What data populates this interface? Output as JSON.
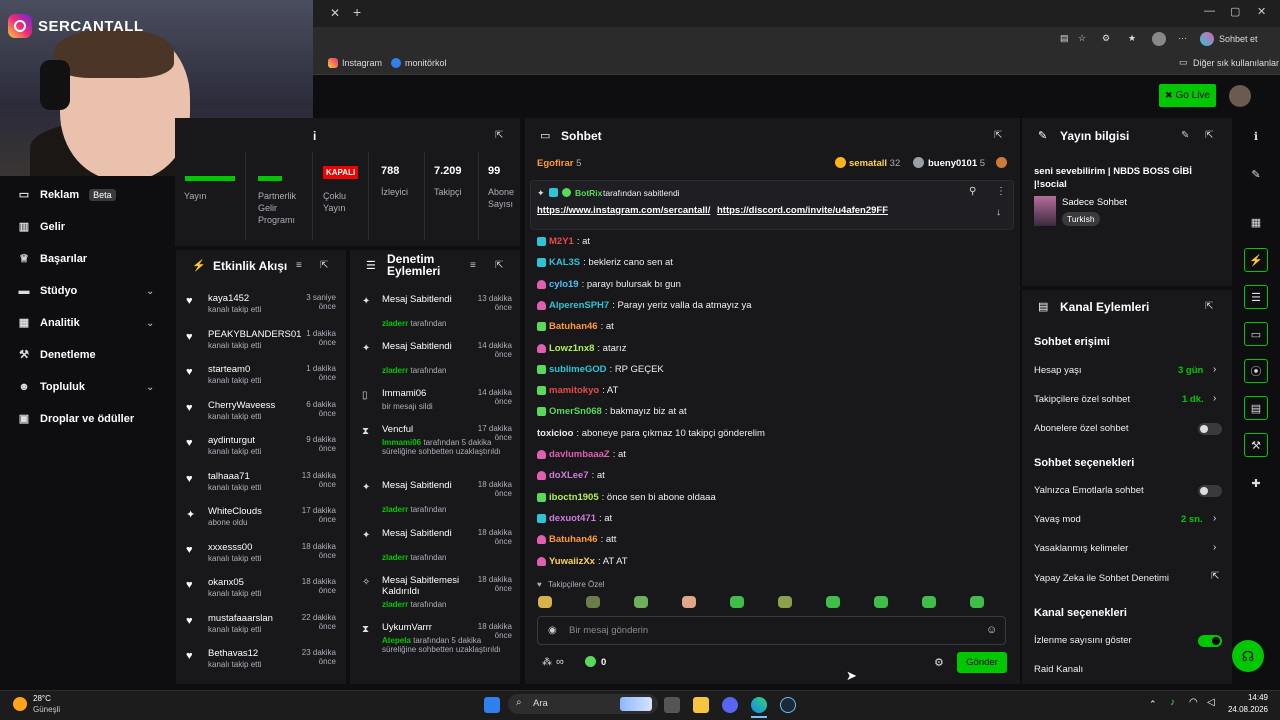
{
  "overlay": {
    "brand": "SERCANTALL"
  },
  "browser": {
    "bookmarks": [
      "Instagram",
      "monitörkol"
    ],
    "other_bookmarks": "Diğer sık kullanılanlar",
    "chat_btn": "Sohbet et"
  },
  "topnav": {
    "go_live": "Go Live"
  },
  "sidebar": {
    "items": [
      {
        "label": "Reklam",
        "badge": "Beta",
        "icon": "megaphone-icon"
      },
      {
        "label": "Gelir",
        "icon": "revenue-icon"
      },
      {
        "label": "Başarılar",
        "icon": "trophy-icon"
      },
      {
        "label": "Stüdyo",
        "icon": "studio-icon"
      },
      {
        "label": "Analitik",
        "icon": "chart-icon"
      },
      {
        "label": "Denetleme",
        "icon": "hammer-icon"
      },
      {
        "label": "Topluluk",
        "icon": "community-icon"
      },
      {
        "label": "Droplar ve ödüller",
        "icon": "gift-icon"
      }
    ]
  },
  "stats": {
    "title_fragment": "i",
    "yayin": "Yayın",
    "partner": "Partnerlik Gelir Programı",
    "kapali": "KAPALI",
    "coklu": "Çoklu Yayın",
    "viewers_value": "788",
    "viewers_label": "İzleyici",
    "followers_value": "7.209",
    "followers_label": "Takipçi",
    "subs_value": "99",
    "subs_label": "Abone Sayısı"
  },
  "activity": {
    "title": "Etkinlik Akışı",
    "items": [
      {
        "name": "kaya1452",
        "time": "3 saniye önce",
        "sub": "kanalı takip etti",
        "icon": "heart-icon"
      },
      {
        "name": "PEAKYBLANDERS01",
        "time": "1 dakika önce",
        "sub": "kanalı takip etti",
        "icon": "heart-icon"
      },
      {
        "name": "starteam0",
        "time": "1 dakika önce",
        "sub": "kanalı takip etti",
        "icon": "heart-icon"
      },
      {
        "name": "CherryWaveess",
        "time": "6 dakika önce",
        "sub": "kanalı takip etti",
        "icon": "heart-icon"
      },
      {
        "name": "aydinturgut",
        "time": "9 dakika önce",
        "sub": "kanalı takip etti",
        "icon": "heart-icon"
      },
      {
        "name": "talhaaa71",
        "time": "13 dakika önce",
        "sub": "kanalı takip etti",
        "icon": "heart-icon"
      },
      {
        "name": "WhiteClouds",
        "time": "17 dakika önce",
        "sub": "abone oldu",
        "icon": "sparkle-icon"
      },
      {
        "name": "xxxesss00",
        "time": "18 dakika önce",
        "sub": "kanalı takip etti",
        "icon": "heart-icon"
      },
      {
        "name": "okanx05",
        "time": "18 dakika önce",
        "sub": "kanalı takip etti",
        "icon": "heart-icon"
      },
      {
        "name": "mustafaaarslan",
        "time": "22 dakika önce",
        "sub": "kanalı takip etti",
        "icon": "heart-icon"
      },
      {
        "name": "Bethavas12",
        "time": "23 dakika önce",
        "sub": "kanalı takip etti",
        "icon": "heart-icon"
      }
    ]
  },
  "moderation": {
    "title": "Denetim Eylemleri",
    "items": [
      {
        "title": "Mesaj Sabitlendi",
        "time": "13 dakika önce",
        "actor": "zladerr",
        "suffix": "tarafından",
        "icon": "pin-icon"
      },
      {
        "title": "Mesaj Sabitlendi",
        "time": "14 dakika önce",
        "actor": "zladerr",
        "suffix": "tarafından",
        "icon": "pin-icon"
      },
      {
        "title": "Immami06",
        "time": "14 dakika önce",
        "actor": "",
        "suffix": "bir mesajı sildi",
        "icon": "trash-icon"
      },
      {
        "title": "Vencful",
        "time": "17 dakika önce",
        "actor": "Immami06",
        "suffix": "tarafından 5 dakika süreliğine sohbetten uzaklaştırıldı",
        "icon": "hourglass-icon"
      },
      {
        "title": "Mesaj Sabitlendi",
        "time": "18 dakika önce",
        "actor": "zladerr",
        "suffix": "tarafından",
        "icon": "pin-icon"
      },
      {
        "title": "Mesaj Sabitlendi",
        "time": "18 dakika önce",
        "actor": "zladerr",
        "suffix": "tarafından",
        "icon": "pin-icon"
      },
      {
        "title": "Mesaj Sabitlemesi Kaldırıldı",
        "time": "18 dakika önce",
        "actor": "zladerr",
        "suffix": "tarafından",
        "icon": "unpin-icon"
      },
      {
        "title": "UykumVarrr",
        "time": "18 dakika önce",
        "actor": "Atepela",
        "suffix": "tarafından 5 dakika süreliğine sohbetten uzaklaştırıldı",
        "icon": "hourglass-icon"
      }
    ]
  },
  "chat": {
    "title": "Sohbet",
    "top_users": [
      {
        "name": "Egofirar",
        "count": "5"
      },
      {
        "name": "sematall",
        "count": "32"
      },
      {
        "name": "bueny0101",
        "count": "5"
      }
    ],
    "pinned": {
      "by": "BotRix",
      "by_suffix": "tarafından sabitlendi",
      "link1": "https://www.instagram.com/sercantall/",
      "link2": "https://discord.com/invite/u4afen29FF"
    },
    "messages": [
      {
        "user": "M2Y1",
        "color": "#e64a4a",
        "text": ": at",
        "badge": "b-cyan"
      },
      {
        "user": "KAL3S",
        "color": "#2ec4d8",
        "text": ": bekleriz cano sen at",
        "badge": "b-cyan"
      },
      {
        "user": "cylo19",
        "color": "#4fc3f7",
        "text": ": parayı bulursak bı gun",
        "badge": "b-pink"
      },
      {
        "user": "AlperenSPH7",
        "color": "#2ec4d8",
        "text": ": Parayı yeriz valla da atmayız ya",
        "badge": "b-pink"
      },
      {
        "user": "Batuhan46",
        "color": "#ff9a3c",
        "text": ": at",
        "badge": "b-green"
      },
      {
        "user": "Lowz1nx8",
        "color": "#b0f050",
        "text": ": atarız",
        "badge": "b-pink"
      },
      {
        "user": "sublimeGOD",
        "color": "#2ec4d8",
        "text": ": RP GEÇEK",
        "badge": "b-green"
      },
      {
        "user": "mamitokyo",
        "color": "#e64a4a",
        "text": ": AT",
        "badge": "b-green"
      },
      {
        "user": "OmerSn068",
        "color": "#59d85a",
        "text": ": bakmayız biz at at",
        "badge": "b-green"
      },
      {
        "user": "toxicioo",
        "color": "#efeff1",
        "text": ": aboneye para çıkmaz 10 takipçi gönderelim",
        "badge": ""
      },
      {
        "user": "davlumbaaaZ",
        "color": "#e05fb0",
        "text": ": at",
        "badge": "b-pink"
      },
      {
        "user": "doXLee7",
        "color": "#d07ae0",
        "text": ": at",
        "badge": "b-pink"
      },
      {
        "user": "iboctn1905",
        "color": "#b0f050",
        "text": ": önce sen bi abone oldaaa",
        "badge": "b-green"
      },
      {
        "user": "dexuot471",
        "color": "#d07ae0",
        "text": ": at",
        "badge": "b-cyan"
      },
      {
        "user": "Batuhan46",
        "color": "#ff9a3c",
        "text": ": att",
        "badge": "b-pink"
      },
      {
        "user": "YuwaiizXx",
        "color": "#ffd34d",
        "text": ": AT AT",
        "badge": "b-pink"
      }
    ],
    "followers_only": "Takipçilere Özel",
    "input_placeholder": "Bir mesaj gönderin",
    "points": "0",
    "send": "Gönder"
  },
  "stream_info": {
    "title": "Yayın bilgisi",
    "stream_title": "seni sevebilirim | NBDS BOSS GİBİ |!social",
    "category": "Sadece Sohbet",
    "tag": "Turkish"
  },
  "channel_actions": {
    "title": "Kanal Eylemleri",
    "chat_access": "Sohbet erişimi",
    "account_age": "Hesap yaşı",
    "account_age_value": "3 gün",
    "followers_chat": "Takipçilere özel sohbet",
    "followers_chat_value": "1 dk.",
    "subs_chat": "Abonelere özel sohbet",
    "chat_options": "Sohbet seçenekleri",
    "emote_only": "Yalnızca Emotlarla sohbet",
    "slow_mode": "Yavaş mod",
    "slow_mode_value": "2 sn.",
    "banned_words": "Yasaklanmış kelimeler",
    "ai_moderation": "Yapay Zeka ile Sohbet Denetimi",
    "channel_options": "Kanal seçenekleri",
    "show_viewers": "İzlenme sayısını göster",
    "raid": "Raid Kanalı"
  },
  "taskbar": {
    "weather_temp": "28°C",
    "weather_desc": "Güneşli",
    "search": "Ara",
    "time": "14:49",
    "date": "24.08.2026"
  },
  "colors": {
    "accent": "#00c800",
    "panel": "#18181b",
    "bg": "#0e0e10"
  }
}
